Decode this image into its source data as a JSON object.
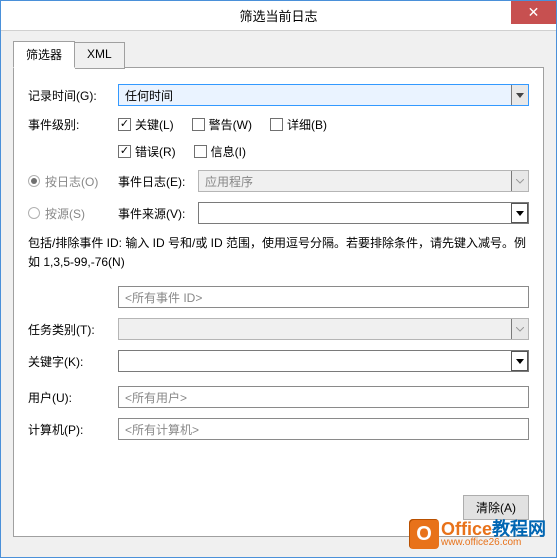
{
  "window": {
    "title": "筛选当前日志",
    "close": "✕"
  },
  "tabs": {
    "filter": "筛选器",
    "xml": "XML"
  },
  "form": {
    "logged_label": "记录时间(G):",
    "logged_value": "任何时间",
    "level_label": "事件级别:",
    "levels": {
      "critical": "关键(L)",
      "warning": "警告(W)",
      "verbose": "详细(B)",
      "error": "错误(R)",
      "info": "信息(I)"
    },
    "bylog_label": "按日志(O)",
    "bysource_label": "按源(S)",
    "eventlog_label": "事件日志(E):",
    "eventlog_value": "应用程序",
    "eventsource_label": "事件来源(V):",
    "help_text": "包括/排除事件 ID: 输入 ID 号和/或 ID 范围，使用逗号分隔。若要排除条件，请先键入减号。例如 1,3,5-99,-76(N)",
    "eventid_placeholder": "<所有事件 ID>",
    "taskcat_label": "任务类别(T):",
    "keywords_label": "关键字(K):",
    "user_label": "用户(U):",
    "user_placeholder": "<所有用户>",
    "computer_label": "计算机(P):",
    "computer_placeholder": "<所有计算机>",
    "clear_btn": "清除(A)"
  },
  "watermark": {
    "brand_left": "Office",
    "brand_right": "教程网",
    "url": "www.office26.com"
  }
}
